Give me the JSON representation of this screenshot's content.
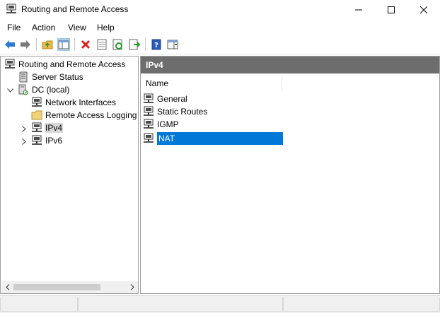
{
  "window": {
    "title": "Routing and Remote Access",
    "icon": "rras-network-icon",
    "controls": [
      "minimize-icon",
      "maximize-icon",
      "close-icon"
    ]
  },
  "menu": [
    {
      "label": "File"
    },
    {
      "label": "Action"
    },
    {
      "label": "View"
    },
    {
      "label": "Help"
    }
  ],
  "toolbar": {
    "buttons": [
      "back-arrow-icon",
      "forward-arrow-icon",
      "up-folder-icon",
      "show-hide-console-tree-icon",
      "delete-icon",
      "properties-icon",
      "refresh-icon",
      "export-list-icon",
      "help-icon",
      "show-hide-action-pane-icon"
    ]
  },
  "tree": {
    "root": "Routing and Remote Access",
    "server_status": "Server Status",
    "server": "DC (local)",
    "network_interfaces": "Network Interfaces",
    "remote_access_logging": "Remote Access Logging",
    "ipv4": "IPv4",
    "ipv6": "IPv6",
    "selected": "IPv4"
  },
  "details": {
    "header": "IPv4",
    "column_name": "Name",
    "items": [
      {
        "label": "General"
      },
      {
        "label": "Static Routes"
      },
      {
        "label": "IGMP"
      },
      {
        "label": "NAT"
      }
    ],
    "selected": "NAT"
  },
  "colors": {
    "selection": "#0078d7",
    "pane_header": "#6d6d6d",
    "tree_selection": "#d9d9d9"
  }
}
